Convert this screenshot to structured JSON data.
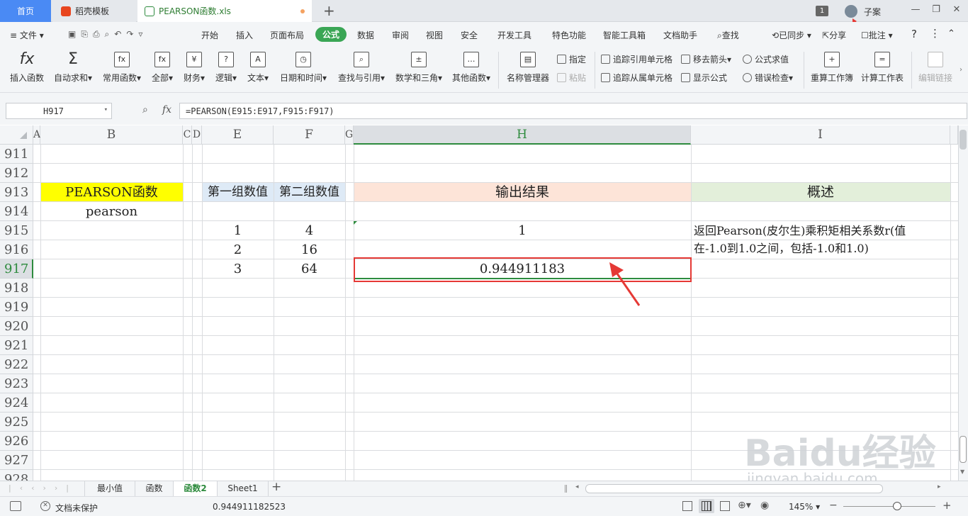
{
  "tabs": {
    "home": "首页",
    "template": "稻壳模板",
    "file": "PEARSON函数.xls",
    "new_tab": "+"
  },
  "titlebar": {
    "badge": "1",
    "user": "子案",
    "minimize": "—",
    "restore": "❐",
    "close": "✕"
  },
  "menu": {
    "file": "文件",
    "items": [
      "开始",
      "插入",
      "页面布局",
      "公式",
      "数据",
      "审阅",
      "视图",
      "安全",
      "开发工具",
      "特色功能",
      "智能工具箱",
      "文档助手"
    ],
    "active": "公式",
    "search": "查找",
    "sync": "已同步",
    "share": "分享",
    "comment": "批注",
    "help": "?"
  },
  "ribbon": {
    "big_buttons": [
      {
        "label": "插入函数",
        "icon": "fx"
      },
      {
        "label": "自动求和▾",
        "icon": "Σ"
      },
      {
        "label": "常用函数▾",
        "icon": "fx"
      },
      {
        "label": "全部▾",
        "icon": "fx"
      },
      {
        "label": "财务▾",
        "icon": "¥"
      },
      {
        "label": "逻辑▾",
        "icon": "?"
      },
      {
        "label": "文本▾",
        "icon": "A"
      },
      {
        "label": "日期和时间▾",
        "icon": "◷"
      },
      {
        "label": "查找与引用▾",
        "icon": "⌕"
      },
      {
        "label": "数学和三角▾",
        "icon": "±"
      },
      {
        "label": "其他函数▾",
        "icon": "…"
      },
      {
        "label": "名称管理器",
        "icon": "▤"
      }
    ],
    "small": {
      "define": "指定",
      "paste": "粘贴",
      "trace_prec": "追踪引用单元格",
      "trace_dep": "追踪从属单元格",
      "remove_arrows": "移去箭头▾",
      "show_formula": "显示公式",
      "eval_formula": "公式求值",
      "error_check": "错误检查▾"
    },
    "right_buttons": [
      {
        "label": "重算工作簿"
      },
      {
        "label": "计算工作表"
      },
      {
        "label": "编辑链接"
      }
    ]
  },
  "formula_bar": {
    "name_box": "H917",
    "fx": "fx",
    "formula": "=PEARSON(E915:E917,F915:F917)"
  },
  "columns": [
    "A",
    "B",
    "C",
    "D",
    "E",
    "F",
    "G",
    "H",
    "I"
  ],
  "rows": [
    "911",
    "912",
    "913",
    "914",
    "915",
    "916",
    "917",
    "918",
    "919",
    "920",
    "921",
    "922",
    "923",
    "924",
    "925",
    "926",
    "927",
    "928"
  ],
  "cells": {
    "b913": "PEARSON函数",
    "b914": "pearson",
    "e913": "第一组数值",
    "f913": "第二组数值",
    "h913": "输出结果",
    "i913": "概述",
    "e915": "1",
    "e916": "2",
    "e917": "3",
    "f915": "4",
    "f916": "16",
    "f917": "64",
    "h915": "1",
    "h917": "0.944911183",
    "i915": "返回Pearson(皮尔生)乘积矩相关系数r(值",
    "i916": "在-1.0到1.0之间，包括-1.0和1.0)"
  },
  "sheets": [
    "最小值",
    "函数",
    "函数2",
    "Sheet1"
  ],
  "active_sheet": "函数2",
  "status": {
    "protect": "文档未保护",
    "value": "0.944911182523",
    "zoom": "145%"
  },
  "watermark": {
    "brand": "Baidu经验",
    "url": "jingyan.baidu.com"
  },
  "colors": {
    "accent": "#3aa655",
    "yellow": "#ffff00",
    "peach": "#fde4d8",
    "lightgreen": "#e3efda",
    "lightblue": "#deeaf6",
    "highlight": "#e53935"
  }
}
